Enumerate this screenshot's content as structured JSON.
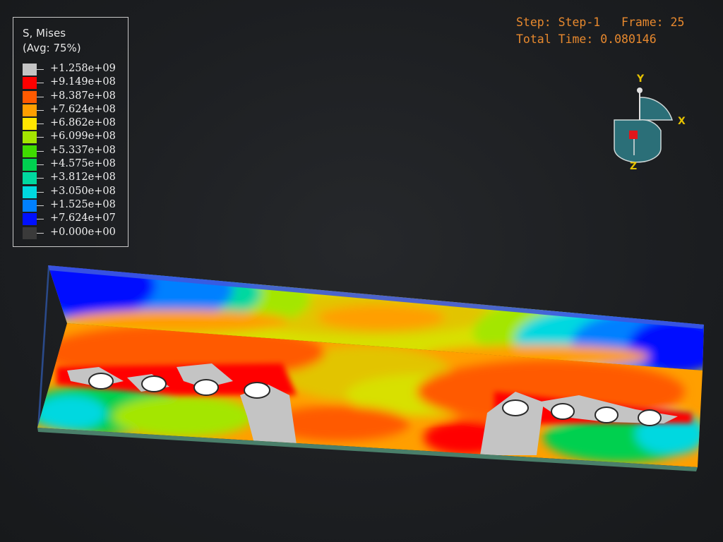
{
  "legend": {
    "title": "S, Mises",
    "subtitle": "(Avg: 75%)",
    "entries": [
      {
        "value": "+1.258e+09",
        "color": "#c4c4c4"
      },
      {
        "value": "+9.149e+08",
        "color": "#ff0000"
      },
      {
        "value": "+8.387e+08",
        "color": "#ff5a00"
      },
      {
        "value": "+7.624e+08",
        "color": "#ff9f00"
      },
      {
        "value": "+6.862e+08",
        "color": "#ffe600"
      },
      {
        "value": "+6.099e+08",
        "color": "#a4e600"
      },
      {
        "value": "+5.337e+08",
        "color": "#3fdc00"
      },
      {
        "value": "+4.575e+08",
        "color": "#00d050"
      },
      {
        "value": "+3.812e+08",
        "color": "#00d8a0"
      },
      {
        "value": "+3.050e+08",
        "color": "#00d8e0"
      },
      {
        "value": "+1.525e+08",
        "color": "#0080ff"
      },
      {
        "value": "+7.624e+07",
        "color": "#0010ff"
      },
      {
        "value": "+0.000e+00",
        "color": "#3a3a3a"
      }
    ]
  },
  "step_info": {
    "line1": "Step: Step-1   Frame: 25",
    "line2": "Total Time: 0.080146"
  },
  "triad": {
    "x_label": "X",
    "y_label": "Y",
    "z_label": "Z"
  },
  "colors": {
    "background": "#1c1e21",
    "step_text": "#e8892e",
    "triad_label": "#e6c200",
    "triad_fill": "#2b6f78"
  }
}
